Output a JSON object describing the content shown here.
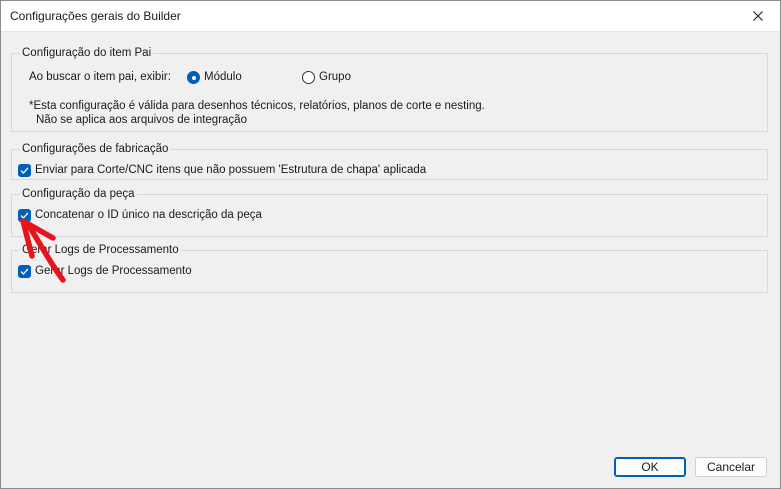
{
  "window": {
    "title": "Configurações gerais do Builder"
  },
  "groups": {
    "parent_item": {
      "legend": "Configuração do item Pai",
      "search_label": "Ao buscar o item pai, exibir:",
      "options": [
        {
          "label": "Módulo",
          "checked": true
        },
        {
          "label": "Grupo",
          "checked": false
        }
      ],
      "note_line1": "*Esta configuração é válida para desenhos técnicos, relatórios, planos de corte e nesting.",
      "note_line2": "Não se aplica aos arquivos de integração"
    },
    "manufacturing": {
      "legend": "Configurações de fabricação",
      "checkbox": {
        "label": "Enviar para Corte/CNC itens que não possuem 'Estrutura de chapa' aplicada",
        "checked": true
      }
    },
    "part": {
      "legend": "Configuração da peça",
      "checkbox": {
        "label": "Concatenar o ID único na descrição da peça",
        "checked": true
      }
    },
    "processing_logs": {
      "legend": "Gerar Logs de Processamento",
      "checkbox": {
        "label": "Gerar Logs de Processamento",
        "checked": true
      }
    }
  },
  "buttons": {
    "ok": "OK",
    "cancel": "Cancelar"
  },
  "colors": {
    "accent": "#005fb8",
    "annotation": "#e8141c"
  },
  "icons": {
    "close": "close-icon",
    "check": "check-icon",
    "annotation": "red-arrow-annotation"
  }
}
